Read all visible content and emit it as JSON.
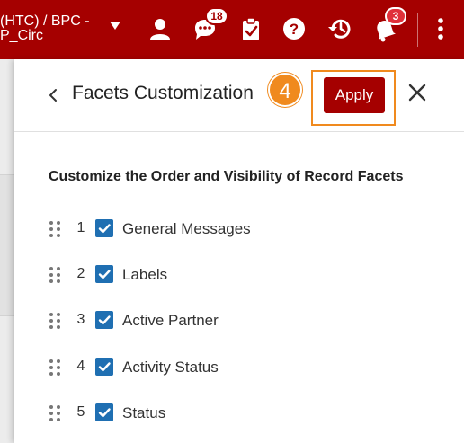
{
  "topbar": {
    "institution_line1": "(HTC) / BPC -",
    "institution_line2": "P_Circ",
    "icons": [
      "user-icon",
      "chat-icon",
      "tasks-clipboard-icon",
      "help-icon",
      "history-icon",
      "notifications-icon",
      "more-vertical-icon"
    ],
    "chat_badge": "18",
    "notifications_badge": "3",
    "color": "#a50000"
  },
  "panel": {
    "title": "Facets Customization",
    "step_number": "4",
    "apply_label": "Apply",
    "section_title": "Customize the Order and Visibility of Record Facets",
    "facets": [
      {
        "number": "1",
        "label": "General Messages",
        "checked": true
      },
      {
        "number": "2",
        "label": "Labels",
        "checked": true
      },
      {
        "number": "3",
        "label": "Active Partner",
        "checked": true
      },
      {
        "number": "4",
        "label": "Activity Status",
        "checked": true
      },
      {
        "number": "5",
        "label": "Status",
        "checked": true
      }
    ],
    "accent_color": "#f08a1e",
    "checkbox_color": "#1f6fb2"
  }
}
